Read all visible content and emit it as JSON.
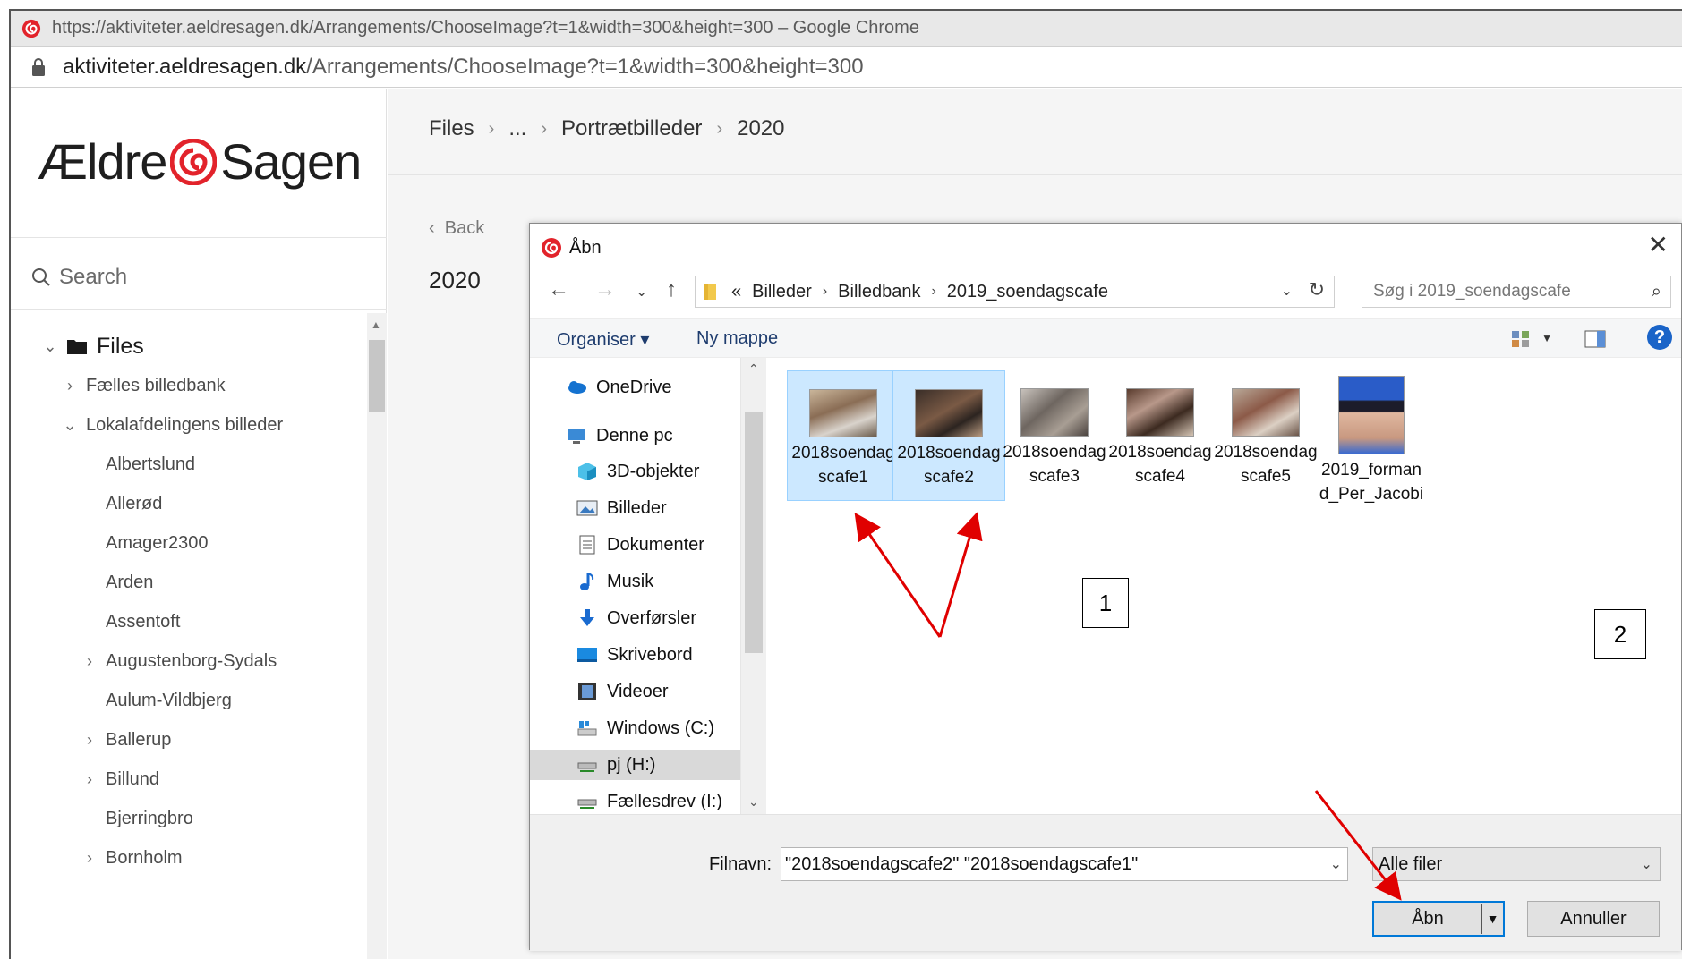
{
  "browser": {
    "title": "https://aktiviteter.aeldresagen.dk/Arrangements/ChooseImage?t=1&width=300&height=300 – Google Chrome",
    "url_host": "aktiviteter.aeldresagen.dk",
    "url_path": "/Arrangements/ChooseImage?t=1&width=300&height=300"
  },
  "brand": {
    "left": "Ældre",
    "right": "Sagen",
    "color": "#e2232b"
  },
  "sidebar": {
    "search_label": "Search",
    "root_label": "Files",
    "items": [
      {
        "label": "Fælles billedbank",
        "chevron": "›"
      },
      {
        "label": "Lokalafdelingens billeder",
        "chevron": "⌄"
      },
      {
        "label": "Albertslund",
        "chevron": ""
      },
      {
        "label": "Allerød",
        "chevron": ""
      },
      {
        "label": "Amager2300",
        "chevron": ""
      },
      {
        "label": "Arden",
        "chevron": ""
      },
      {
        "label": "Assentoft",
        "chevron": ""
      },
      {
        "label": "Augustenborg-Sydals",
        "chevron": "›"
      },
      {
        "label": "Aulum-Vildbjerg",
        "chevron": ""
      },
      {
        "label": "Ballerup",
        "chevron": "›"
      },
      {
        "label": "Billund",
        "chevron": "›"
      },
      {
        "label": "Bjerringbro",
        "chevron": ""
      },
      {
        "label": "Bornholm",
        "chevron": "›"
      }
    ]
  },
  "main": {
    "breadcrumb": [
      "Files",
      "...",
      "Portrætbilleder",
      "2020"
    ],
    "back_label": "Back",
    "title": "2020"
  },
  "dialog": {
    "title": "Åbn",
    "close": "✕",
    "path": [
      "Billeder",
      "Billedbank",
      "2019_soendagscafe"
    ],
    "path_prefix": "«",
    "search_placeholder": "Søg i 2019_soendagscafe",
    "toolbar": {
      "organise": "Organiser ▾",
      "new_folder": "Ny mappe",
      "help": "?"
    },
    "nav": [
      {
        "label": "OneDrive",
        "icon": "cloud-icon"
      },
      {
        "label": "Denne pc",
        "icon": "computer-icon"
      },
      {
        "label": "3D-objekter",
        "icon": "cube-icon"
      },
      {
        "label": "Billeder",
        "icon": "pictures-icon"
      },
      {
        "label": "Dokumenter",
        "icon": "document-icon"
      },
      {
        "label": "Musik",
        "icon": "music-icon"
      },
      {
        "label": "Overførsler",
        "icon": "download-icon"
      },
      {
        "label": "Skrivebord",
        "icon": "desktop-icon"
      },
      {
        "label": "Videoer",
        "icon": "video-icon"
      },
      {
        "label": "Windows (C:)",
        "icon": "drive-icon"
      },
      {
        "label": "pj (H:)",
        "icon": "network-drive-icon"
      },
      {
        "label": "Fællesdrev (I:)",
        "icon": "network-drive-icon"
      }
    ],
    "files": [
      {
        "name": "2018soendagscafe1",
        "selected": true
      },
      {
        "name": "2018soendagscafe2",
        "selected": true
      },
      {
        "name": "2018soendagscafe3",
        "selected": false
      },
      {
        "name": "2018soendagscafe4",
        "selected": false
      },
      {
        "name": "2018soendagscafe5",
        "selected": false
      },
      {
        "name": "2019_formand_Per_Jacobi",
        "selected": false
      }
    ],
    "filename_label": "Filnavn:",
    "filename_value": "\"2018soendagscafe2\" \"2018soendagscafe1\"",
    "filetype": "Alle filer",
    "open_label": "Åbn",
    "cancel_label": "Annuller"
  },
  "annotations": {
    "step1": "1",
    "step2": "2",
    "arrow_color": "#e00000"
  }
}
